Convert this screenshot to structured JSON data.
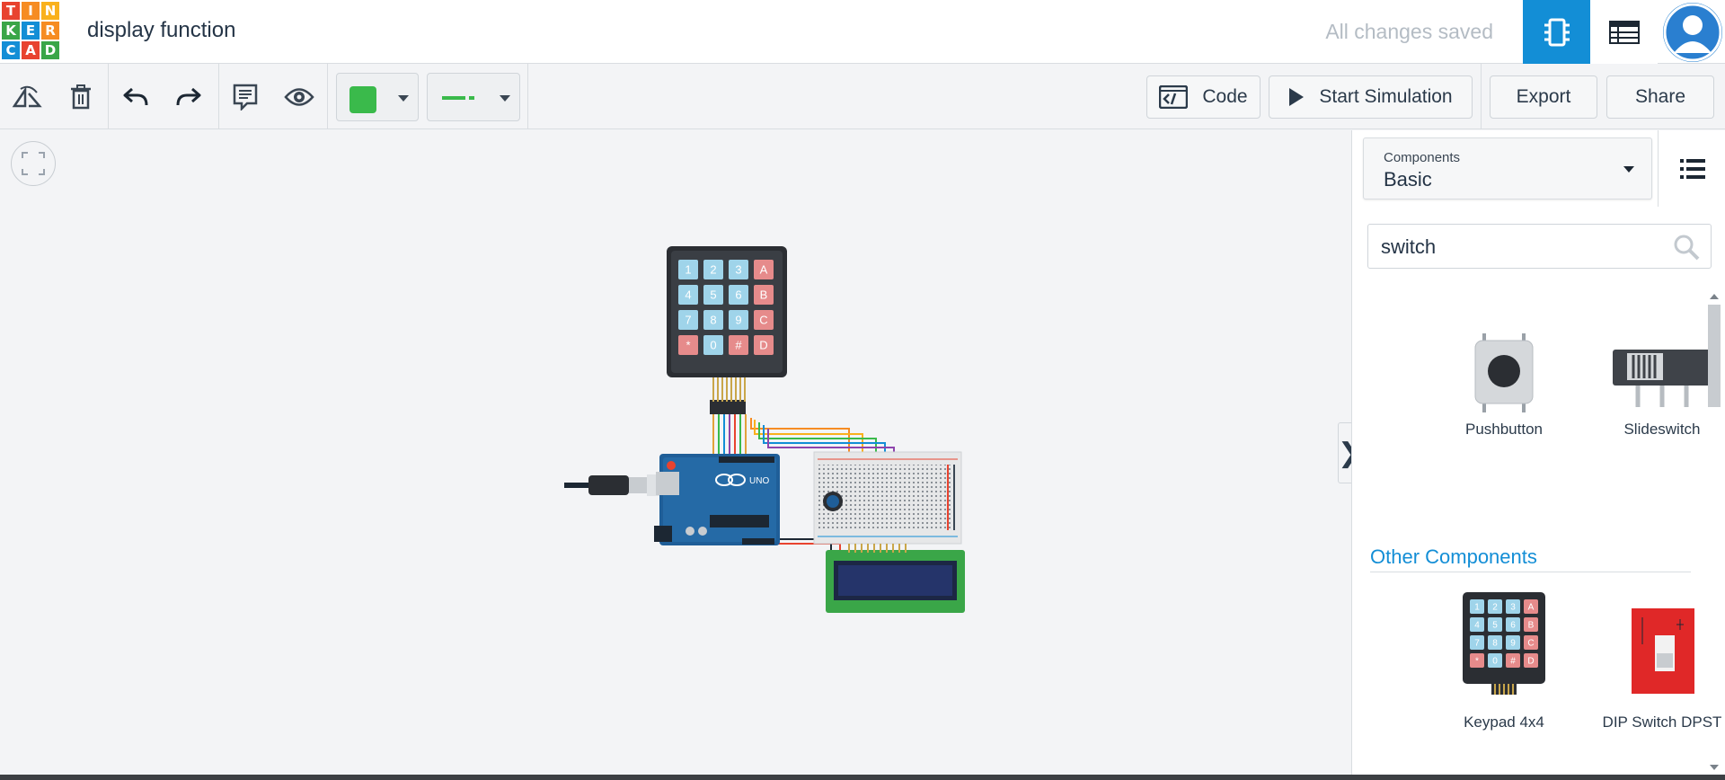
{
  "app": {
    "logo_letters": [
      "T",
      "I",
      "N",
      "K",
      "E",
      "R",
      "C",
      "A",
      "D"
    ],
    "logo_colors": [
      "#e8432f",
      "#f68c23",
      "#f9b11c",
      "#3aa648",
      "#138ed6",
      "#f68c23",
      "#138ed6",
      "#e8432f",
      "#3aa648"
    ],
    "project_title": "display function",
    "save_status": "All changes saved",
    "accent": "#138ed6"
  },
  "header": {
    "circuit_view_icon": "circuit-chip-icon",
    "schematic_view_icon": "table-list-icon",
    "avatar_icon": "user-avatar-icon"
  },
  "toolbar": {
    "tools": [
      "rotate-icon",
      "trash-icon",
      "undo-icon",
      "redo-icon",
      "notes-icon",
      "eye-icon"
    ],
    "fill_color": "#3aba4b",
    "line_color": "#3aba4b",
    "code_label": "Code",
    "simulate_label": "Start Simulation",
    "export_label": "Export",
    "share_label": "Share"
  },
  "panel": {
    "dropdown_label": "Components",
    "dropdown_value": "Basic",
    "search_value": "switch",
    "results": [
      {
        "label": "Pushbutton",
        "icon": "pushbutton-icon"
      },
      {
        "label": "Slideswitch",
        "icon": "slideswitch-icon"
      }
    ],
    "section_title": "Other Components",
    "other": [
      {
        "label": "Keypad 4x4",
        "icon": "keypad-icon"
      },
      {
        "label": "DIP Switch DPST",
        "icon": "dip-switch-icon"
      }
    ],
    "collapse_glyph": "❯"
  },
  "canvas": {
    "keypad_keys": [
      "1",
      "2",
      "3",
      "A",
      "4",
      "5",
      "6",
      "B",
      "7",
      "8",
      "9",
      "C",
      "*",
      "0",
      "#",
      "D"
    ],
    "keypad_colors": {
      "digit": "#9fd4ea",
      "letter": "#e68b8b"
    },
    "board_text": "UNO"
  }
}
